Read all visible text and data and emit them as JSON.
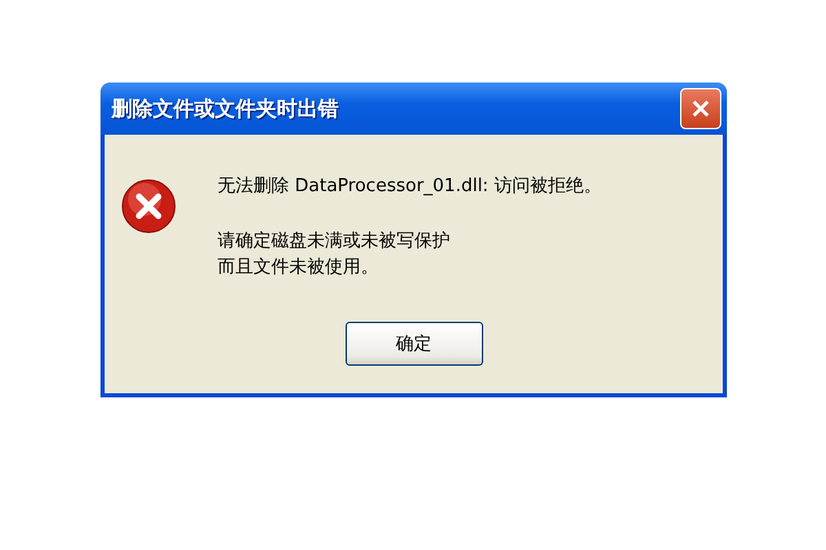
{
  "window": {
    "title": "删除文件或文件夹时出错"
  },
  "message": {
    "line": "无法删除 DataProcessor_01.dll: 访问被拒绝。",
    "detail": [
      "请确定磁盘未满或未被写保护",
      "而且文件未被使用。"
    ]
  },
  "buttons": [
    "确定"
  ]
}
